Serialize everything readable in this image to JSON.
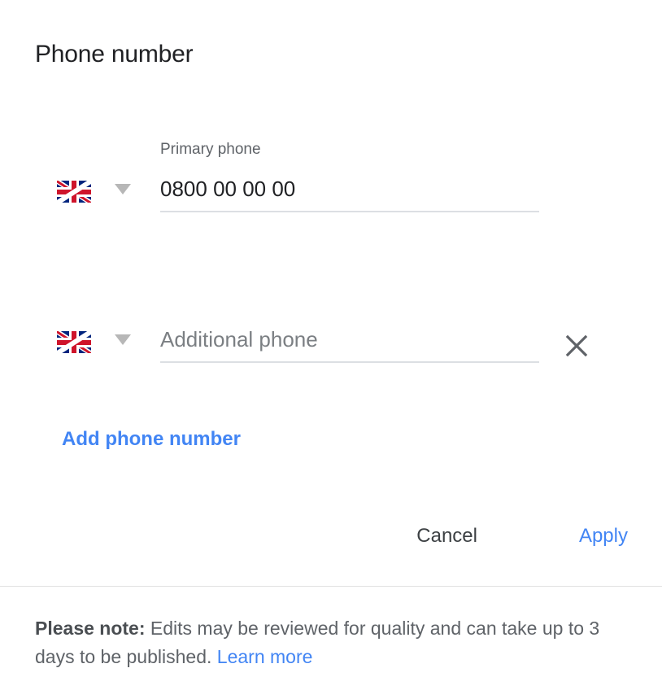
{
  "dialog": {
    "title": "Phone number"
  },
  "phones": [
    {
      "label": "Primary phone",
      "value": "0800 00 00 00",
      "placeholder": "",
      "country_flag": "uk-flag-icon",
      "removable": false
    },
    {
      "label": "",
      "value": "",
      "placeholder": "Additional phone",
      "country_flag": "uk-flag-icon",
      "removable": true
    }
  ],
  "add_phone": {
    "label": "Add phone number"
  },
  "actions": {
    "cancel_label": "Cancel",
    "apply_label": "Apply"
  },
  "footer": {
    "note_bold": "Please note:",
    "note_text": " Edits may be reviewed for quality and can take up to 3 days to be published. ",
    "link_label": "Learn more"
  },
  "colors": {
    "accent_blue": "#4285f4",
    "text_primary": "#202124",
    "text_secondary": "#5f6368",
    "underline": "#dcdfe3",
    "divider": "#e0e0e0",
    "caret_gray": "#b7b7b7"
  }
}
